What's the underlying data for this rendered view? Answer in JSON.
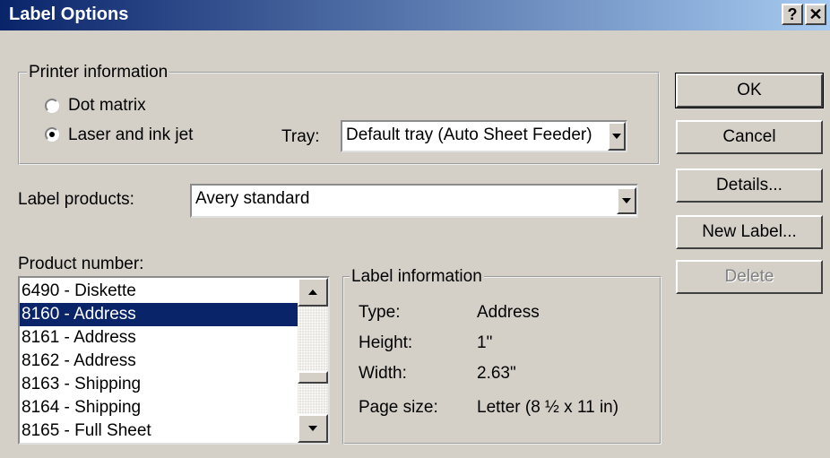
{
  "window": {
    "title": "Label Options",
    "help_btn": "?",
    "close_btn": "✕"
  },
  "printer_info": {
    "legend": "Printer information",
    "dot_matrix": "Dot matrix",
    "laser": "Laser and ink jet",
    "selected": "Laser and ink jet",
    "tray_label": "Tray:",
    "tray_value": "Default tray (Auto Sheet Feeder)"
  },
  "label_products": {
    "label": "Label products:",
    "value": "Avery standard"
  },
  "product_number": {
    "label": "Product number:",
    "items": [
      "6490 - Diskette",
      "8160 - Address",
      "8161 - Address",
      "8162 - Address",
      "8163 - Shipping",
      "8164 - Shipping",
      "8165 - Full Sheet"
    ],
    "selected": "8160 - Address"
  },
  "label_info": {
    "legend": "Label information",
    "rows": [
      {
        "label": "Type:",
        "value": "Address"
      },
      {
        "label": "Height:",
        "value": "1\""
      },
      {
        "label": "Width:",
        "value": "2.63\""
      },
      {
        "label": "Page size:",
        "value": "Letter (8 ½ x 11 in)"
      }
    ]
  },
  "buttons": {
    "ok": "OK",
    "cancel": "Cancel",
    "details": "Details...",
    "new_label": "New Label...",
    "delete": "Delete"
  },
  "colors": {
    "title_start": "#0a246a",
    "title_end": "#a6caf0",
    "face": "#d4d0c8",
    "selection": "#0a246a"
  }
}
